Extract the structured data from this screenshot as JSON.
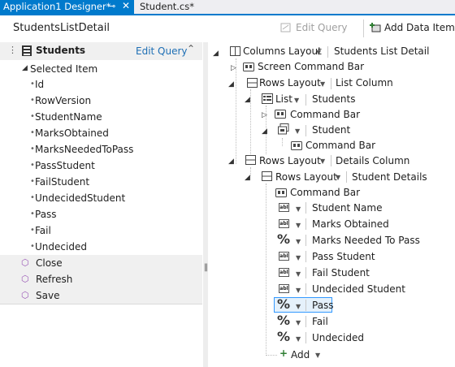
{
  "tabs": {
    "active": "Application1 Designer*",
    "pin": "⊸",
    "close": "✕",
    "inactive": "Student.cs*"
  },
  "header": {
    "title": "StudentsListDetail",
    "edit_query": "Edit Query",
    "add_data_item": "Add Data Item..."
  },
  "left": {
    "title": "Students",
    "edit_query": "Edit Query",
    "selected_item": "Selected Item",
    "fields": [
      "Id",
      "RowVersion",
      "StudentName",
      "MarksObtained",
      "MarksNeededToPass",
      "PassStudent",
      "FailStudent",
      "UndecidedStudent",
      "Pass",
      "Fail",
      "Undecided"
    ],
    "methods": [
      "Close",
      "Refresh",
      "Save"
    ]
  },
  "tree": {
    "root_type": "Columns Layout",
    "root_name": "Students List Detail",
    "screen_cmd": "Screen Command Bar",
    "rows1_type": "Rows Layout",
    "rows1_name": "List Column",
    "list_type": "List",
    "list_name": "Students",
    "list_cmd": "Command Bar",
    "student": "Student",
    "student_cmd": "Command Bar",
    "rows2_type": "Rows Layout",
    "rows2_name": "Details Column",
    "rows3_type": "Rows Layout",
    "rows3_name": "Student Details",
    "details_cmd": "Command Bar",
    "items": [
      "Student Name",
      "Marks Obtained",
      "Marks Needed To Pass",
      "Pass Student",
      "Fail Student",
      "Undecided Student",
      "Pass",
      "Fail",
      "Undecided"
    ],
    "add": "Add",
    "percent_symbol": "%",
    "abl_symbol": "abl"
  }
}
